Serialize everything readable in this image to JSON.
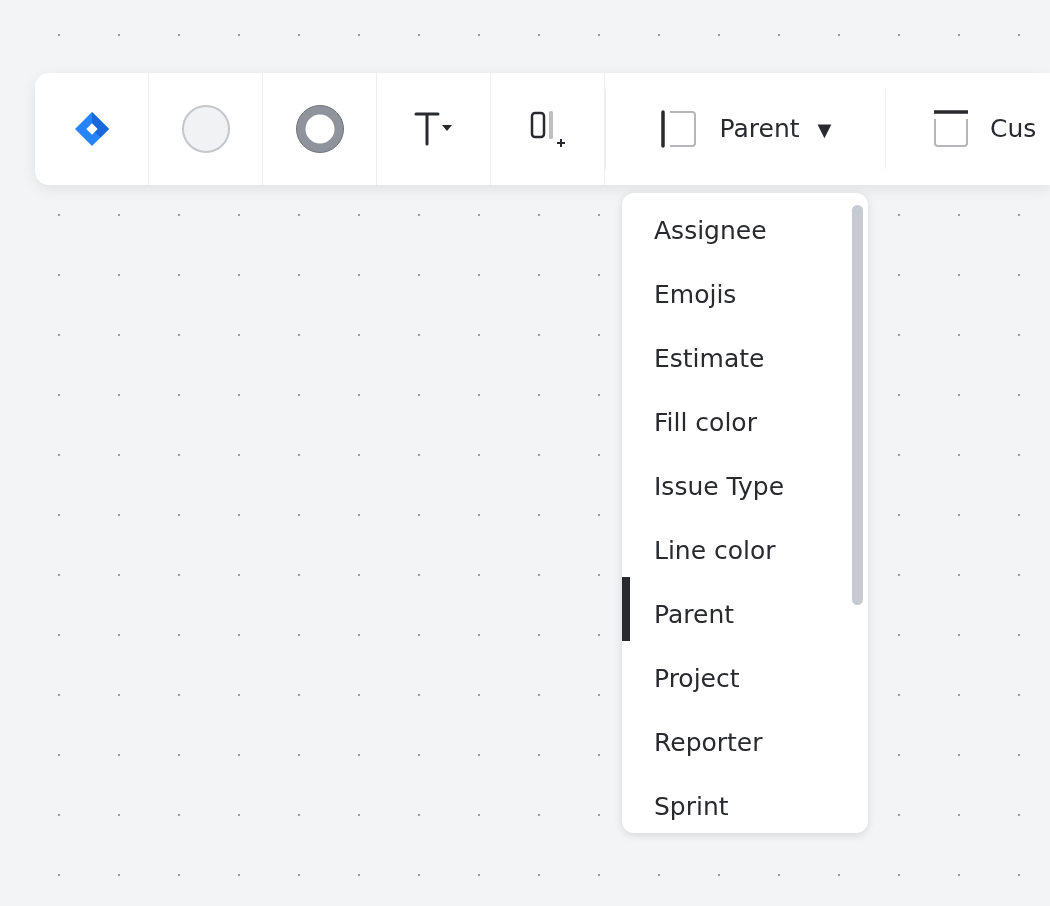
{
  "toolbar": {
    "group_by": {
      "label": "Parent",
      "caret": "▼"
    },
    "layout": {
      "label": "Cus"
    }
  },
  "dropdown": {
    "items": [
      {
        "label": "Assignee",
        "selected": false
      },
      {
        "label": "Emojis",
        "selected": false
      },
      {
        "label": "Estimate",
        "selected": false
      },
      {
        "label": "Fill color",
        "selected": false
      },
      {
        "label": "Issue Type",
        "selected": false
      },
      {
        "label": "Line color",
        "selected": false
      },
      {
        "label": "Parent",
        "selected": true
      },
      {
        "label": "Project",
        "selected": false
      },
      {
        "label": "Reporter",
        "selected": false
      },
      {
        "label": "Sprint",
        "selected": false
      }
    ]
  }
}
